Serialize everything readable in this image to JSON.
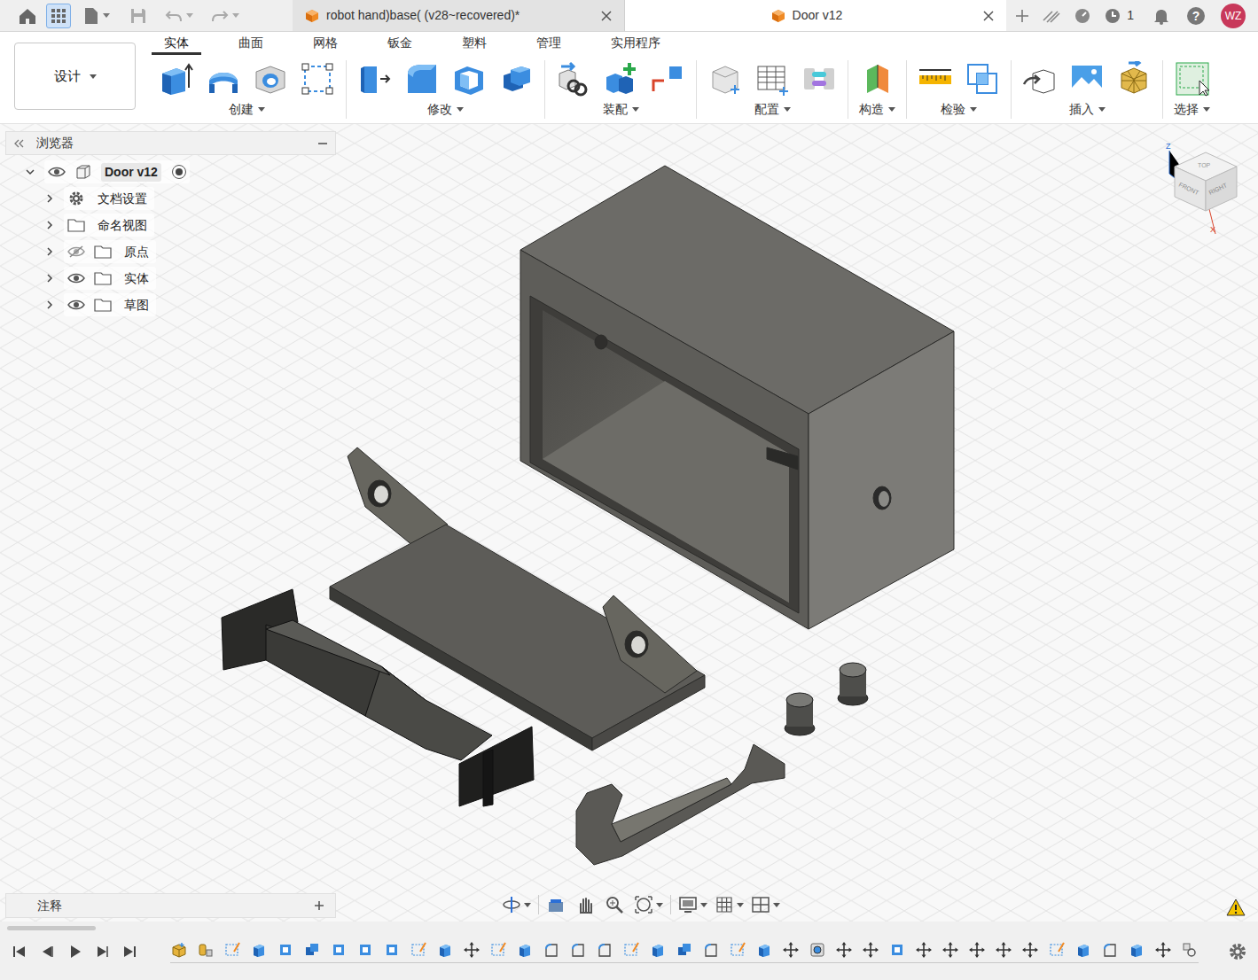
{
  "window_tabs": [
    {
      "label": "robot hand)base( (v28~recovered)*",
      "selected": false
    },
    {
      "label": "Door v12",
      "selected": true
    }
  ],
  "header": {
    "job_count": "1",
    "help": "?",
    "avatar": "WZ"
  },
  "workspace": {
    "label": "设计"
  },
  "ribbon_tabs": [
    {
      "label": "实体",
      "selected": true
    },
    {
      "label": "曲面",
      "selected": false
    },
    {
      "label": "网格",
      "selected": false
    },
    {
      "label": "钣金",
      "selected": false
    },
    {
      "label": "塑料",
      "selected": false
    },
    {
      "label": "管理",
      "selected": false
    },
    {
      "label": "实用程序",
      "selected": false
    }
  ],
  "ribbon_groups": [
    {
      "label": "创建",
      "icons": [
        "extrude",
        "revolve",
        "hole",
        "sketch"
      ]
    },
    {
      "label": "修改",
      "icons": [
        "press-pull",
        "fillet",
        "shell",
        "combine"
      ]
    },
    {
      "label": "装配",
      "icons": [
        "joint",
        "new-component",
        "rigid"
      ]
    },
    {
      "label": "配置",
      "icons": [
        "config-box",
        "table",
        "config-flow"
      ]
    },
    {
      "label": "构造",
      "icons": [
        "plane"
      ]
    },
    {
      "label": "检验",
      "icons": [
        "measure",
        "interference"
      ]
    },
    {
      "label": "插入",
      "icons": [
        "insert",
        "canvas",
        "mesh"
      ]
    },
    {
      "label": "选择",
      "icons": [
        "select"
      ]
    }
  ],
  "browser": {
    "title": "浏览器",
    "items": [
      {
        "label": "Door v12",
        "kind": "root",
        "expanded": true,
        "visibility": "shown",
        "active": true
      },
      {
        "label": "文档设置",
        "kind": "settings",
        "expanded": false,
        "visibility": "none",
        "active": false
      },
      {
        "label": "命名视图",
        "kind": "folder",
        "expanded": false,
        "visibility": "none",
        "active": false
      },
      {
        "label": "原点",
        "kind": "folder",
        "expanded": false,
        "visibility": "hidden",
        "active": false
      },
      {
        "label": "实体",
        "kind": "folder",
        "expanded": false,
        "visibility": "shown",
        "active": false
      },
      {
        "label": "草图",
        "kind": "folder",
        "expanded": false,
        "visibility": "shown",
        "active": false
      }
    ]
  },
  "viewcube": {
    "top": "TOP",
    "front": "FRONT",
    "right": "RIGHT",
    "z_axis": "Z",
    "x_axis": "X"
  },
  "notes": {
    "title": "注释"
  },
  "nav_tools": [
    {
      "kind": "orbit",
      "has_menu": true
    },
    {
      "kind": "look-at",
      "has_menu": false
    },
    {
      "kind": "pan",
      "has_menu": false
    },
    {
      "kind": "zoom",
      "has_menu": false
    },
    {
      "kind": "fit",
      "has_menu": true
    },
    {
      "kind": "display",
      "has_menu": true
    },
    {
      "kind": "grid",
      "has_menu": true
    },
    {
      "kind": "viewports",
      "has_menu": true
    }
  ],
  "timeline": {
    "controls": [
      "first",
      "prev",
      "play",
      "next",
      "last"
    ],
    "features": [
      "component",
      "component-derive",
      "sketch",
      "extrude",
      "shell",
      "combine",
      "shell",
      "shell",
      "shell",
      "sketch",
      "extrude",
      "move",
      "sketch",
      "extrude",
      "fillet",
      "fillet",
      "fillet",
      "sketch",
      "extrude",
      "combine",
      "fillet",
      "sketch",
      "extrude",
      "move",
      "hole",
      "move",
      "move",
      "shell",
      "move",
      "move",
      "move",
      "move",
      "move",
      "sketch",
      "extrude",
      "fillet",
      "extrude",
      "move",
      "joint"
    ]
  }
}
